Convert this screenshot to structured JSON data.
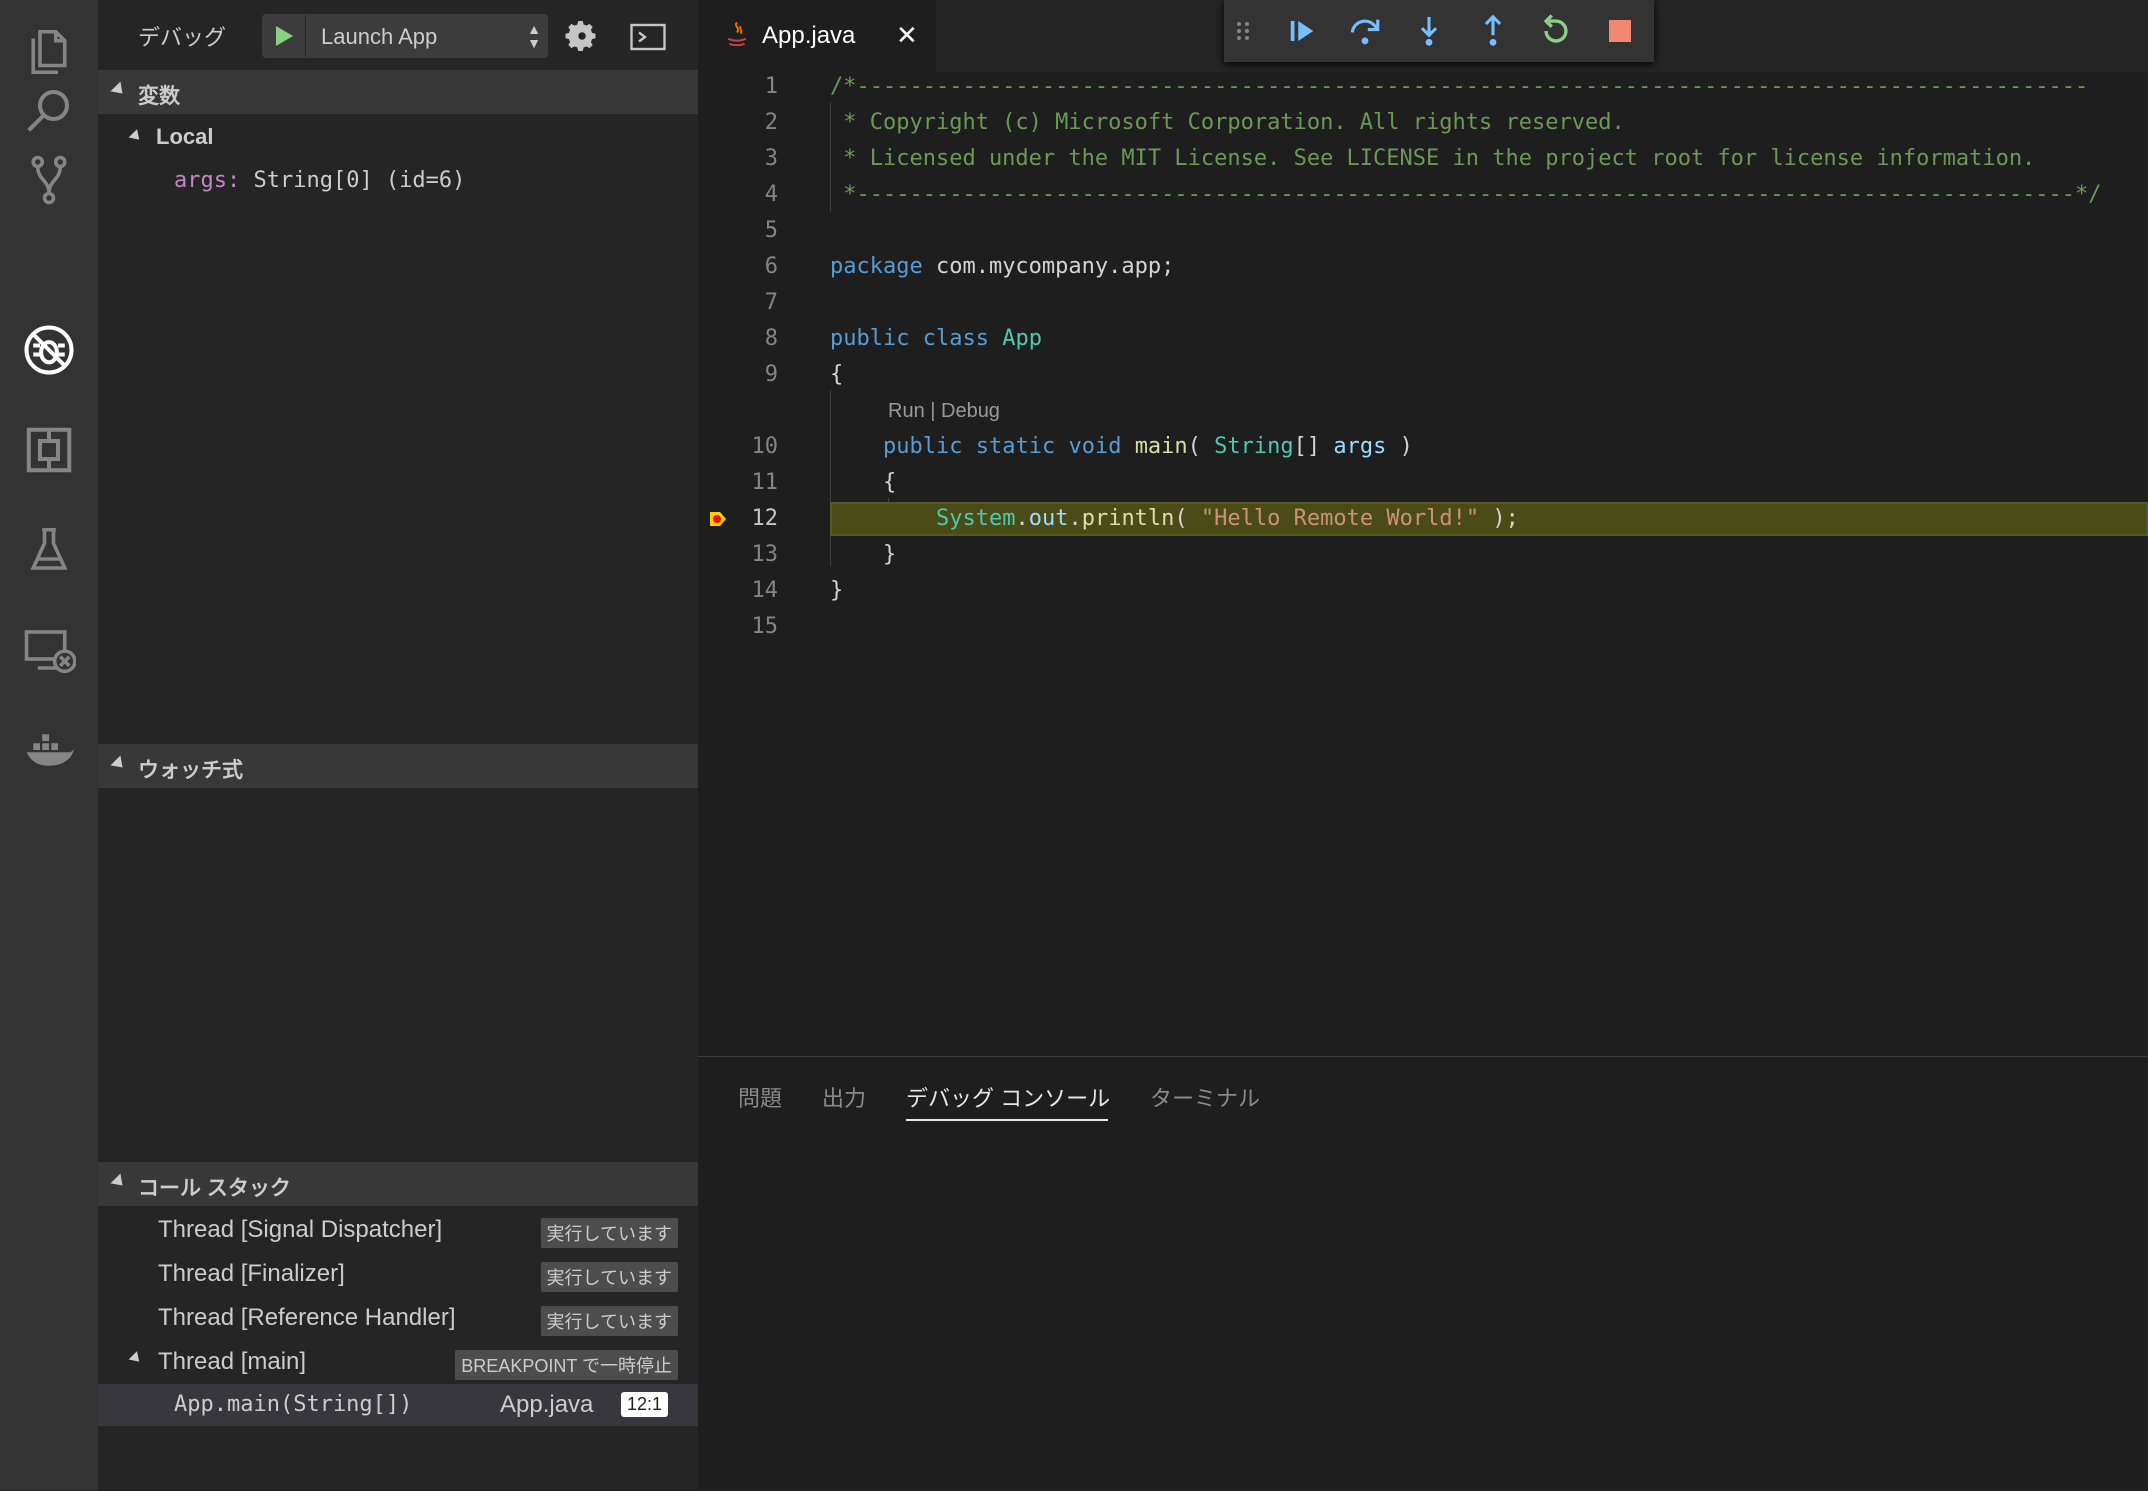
{
  "activity_bar": {
    "items": [
      {
        "name": "explorer-icon"
      },
      {
        "name": "search-icon"
      },
      {
        "name": "source-control-icon"
      },
      {
        "name": "debug-icon"
      },
      {
        "name": "extensions-icon"
      },
      {
        "name": "test-icon"
      },
      {
        "name": "remote-explorer-icon"
      },
      {
        "name": "docker-icon"
      }
    ],
    "active_index": 3
  },
  "sidebar": {
    "title": "デバッグ",
    "launch_config": "Launch App",
    "variables": {
      "header": "変数",
      "scope": "Local",
      "items": [
        {
          "name": "args:",
          "value": "String[0] (id=6)"
        }
      ]
    },
    "watch": {
      "header": "ウォッチ式"
    },
    "call_stack": {
      "header": "コール スタック",
      "threads": [
        {
          "name": "Thread [Signal Dispatcher]",
          "status": "実行しています"
        },
        {
          "name": "Thread [Finalizer]",
          "status": "実行しています"
        },
        {
          "name": "Thread [Reference Handler]",
          "status": "実行しています"
        },
        {
          "name": "Thread [main]",
          "status": "BREAKPOINT で一時停止"
        }
      ],
      "frame": {
        "function": "App.main(String[])",
        "file": "App.java",
        "position": "12:1"
      }
    }
  },
  "editor": {
    "tab": {
      "label": "App.java",
      "close": "✕"
    },
    "code_lens": "Run | Debug",
    "active_line": 12,
    "line_numbers": [
      "1",
      "2",
      "3",
      "4",
      "5",
      "6",
      "7",
      "8",
      "9",
      "10",
      "11",
      "12",
      "13",
      "14",
      "15"
    ]
  },
  "debug_toolbar": {
    "buttons": [
      "drag-handle-icon",
      "continue-icon",
      "step-over-icon",
      "step-into-icon",
      "step-out-icon",
      "restart-icon",
      "stop-icon"
    ],
    "colors": {
      "blue": "#75beff",
      "green": "#89d185",
      "red": "#f48771"
    }
  },
  "panel": {
    "tabs": [
      "問題",
      "出力",
      "デバッグ コンソール",
      "ターミナル"
    ],
    "active_index": 2
  }
}
